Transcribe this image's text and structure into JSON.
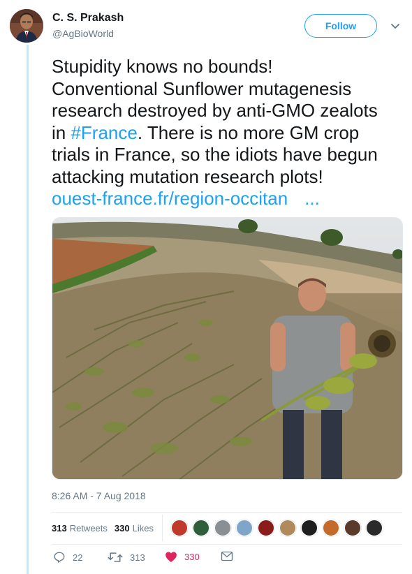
{
  "author": {
    "name": "C. S. Prakash",
    "handle": "@AgBioWorld"
  },
  "follow_label": "Follow",
  "tweet": {
    "lines": [
      "Stupidity knows no bounds!",
      "Conventional Sunflower mutagenesis",
      "research destroyed by anti-GMO zealots"
    ],
    "line4_prefix": "in ",
    "hashtag": "#France",
    "line4_suffix": ". There is no more GM crop",
    "line5": "trials in France, so the idiots have begun",
    "line6": "attacking mutation research plots!",
    "link": "ouest-france.fr/region-occitan",
    "link_ellipsis": "..."
  },
  "timestamp": "8:26 AM - 7 Aug 2018",
  "stats": {
    "retweets_count": "313",
    "retweets_label": "Retweets",
    "likes_count": "330",
    "likes_label": "Likes"
  },
  "likers": [
    {
      "color": "#c0392b"
    },
    {
      "color": "#2e5e3a"
    },
    {
      "color": "#8a8f93"
    },
    {
      "color": "#7fa6c9"
    },
    {
      "color": "#8b1c1c"
    },
    {
      "color": "#b08a5a"
    },
    {
      "color": "#1f1f1f"
    },
    {
      "color": "#c46a2a"
    },
    {
      "color": "#5a3b2b"
    },
    {
      "color": "#2a2a2a"
    }
  ],
  "actions": {
    "reply_count": "22",
    "retweet_count": "313",
    "like_count": "330"
  },
  "colors": {
    "accent": "#1da1f2",
    "like": "#e0245e",
    "thread_line": "#cce6f7"
  }
}
